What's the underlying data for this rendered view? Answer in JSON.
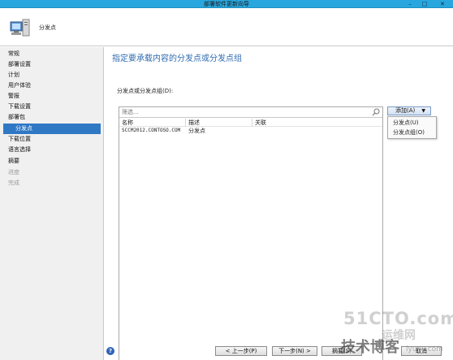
{
  "window": {
    "title": "部署软件更新向导",
    "controls": [
      "–",
      "□",
      "✕"
    ]
  },
  "header": {
    "page": "分发点",
    "icon": "computer-wizard-icon"
  },
  "sidebar": {
    "items": [
      {
        "label": "常规",
        "state": "normal"
      },
      {
        "label": "部署设置",
        "state": "normal"
      },
      {
        "label": "计划",
        "state": "normal"
      },
      {
        "label": "用户体验",
        "state": "normal"
      },
      {
        "label": "警报",
        "state": "normal"
      },
      {
        "label": "下载设置",
        "state": "normal"
      },
      {
        "label": "部署包",
        "state": "normal"
      },
      {
        "label": "分发点",
        "state": "selected"
      },
      {
        "label": "下载位置",
        "state": "normal"
      },
      {
        "label": "语言选择",
        "state": "normal"
      },
      {
        "label": "摘要",
        "state": "normal"
      },
      {
        "label": "进度",
        "state": "disabled"
      },
      {
        "label": "完成",
        "state": "disabled"
      }
    ]
  },
  "main": {
    "heading": "指定要承载内容的分发点或分发点组",
    "field_label": "分发点或分发点组(D):",
    "filter_placeholder": "筛选...",
    "columns": [
      "名称",
      "描述",
      "关联"
    ],
    "rows": [
      {
        "name": "SCCM2012.CONTOSO.COM",
        "description": "分发点",
        "association": ""
      }
    ],
    "add_button": "添加(A)",
    "add_menu": [
      "分发点(U)",
      "分发点组(O)"
    ]
  },
  "footer": {
    "help": "?",
    "prev": "< 上一步(P)",
    "next": "下一步(N) >",
    "summary": "摘要(S)",
    "cancel": "取消"
  },
  "watermark": {
    "line1": "51CTO.com",
    "line2": "运维网",
    "line3": "技术博客",
    "line4": "iyunv.com"
  },
  "colors": {
    "titlebar": "#28a7de",
    "selected": "#2f78c4",
    "heading": "#2f6bb0"
  }
}
